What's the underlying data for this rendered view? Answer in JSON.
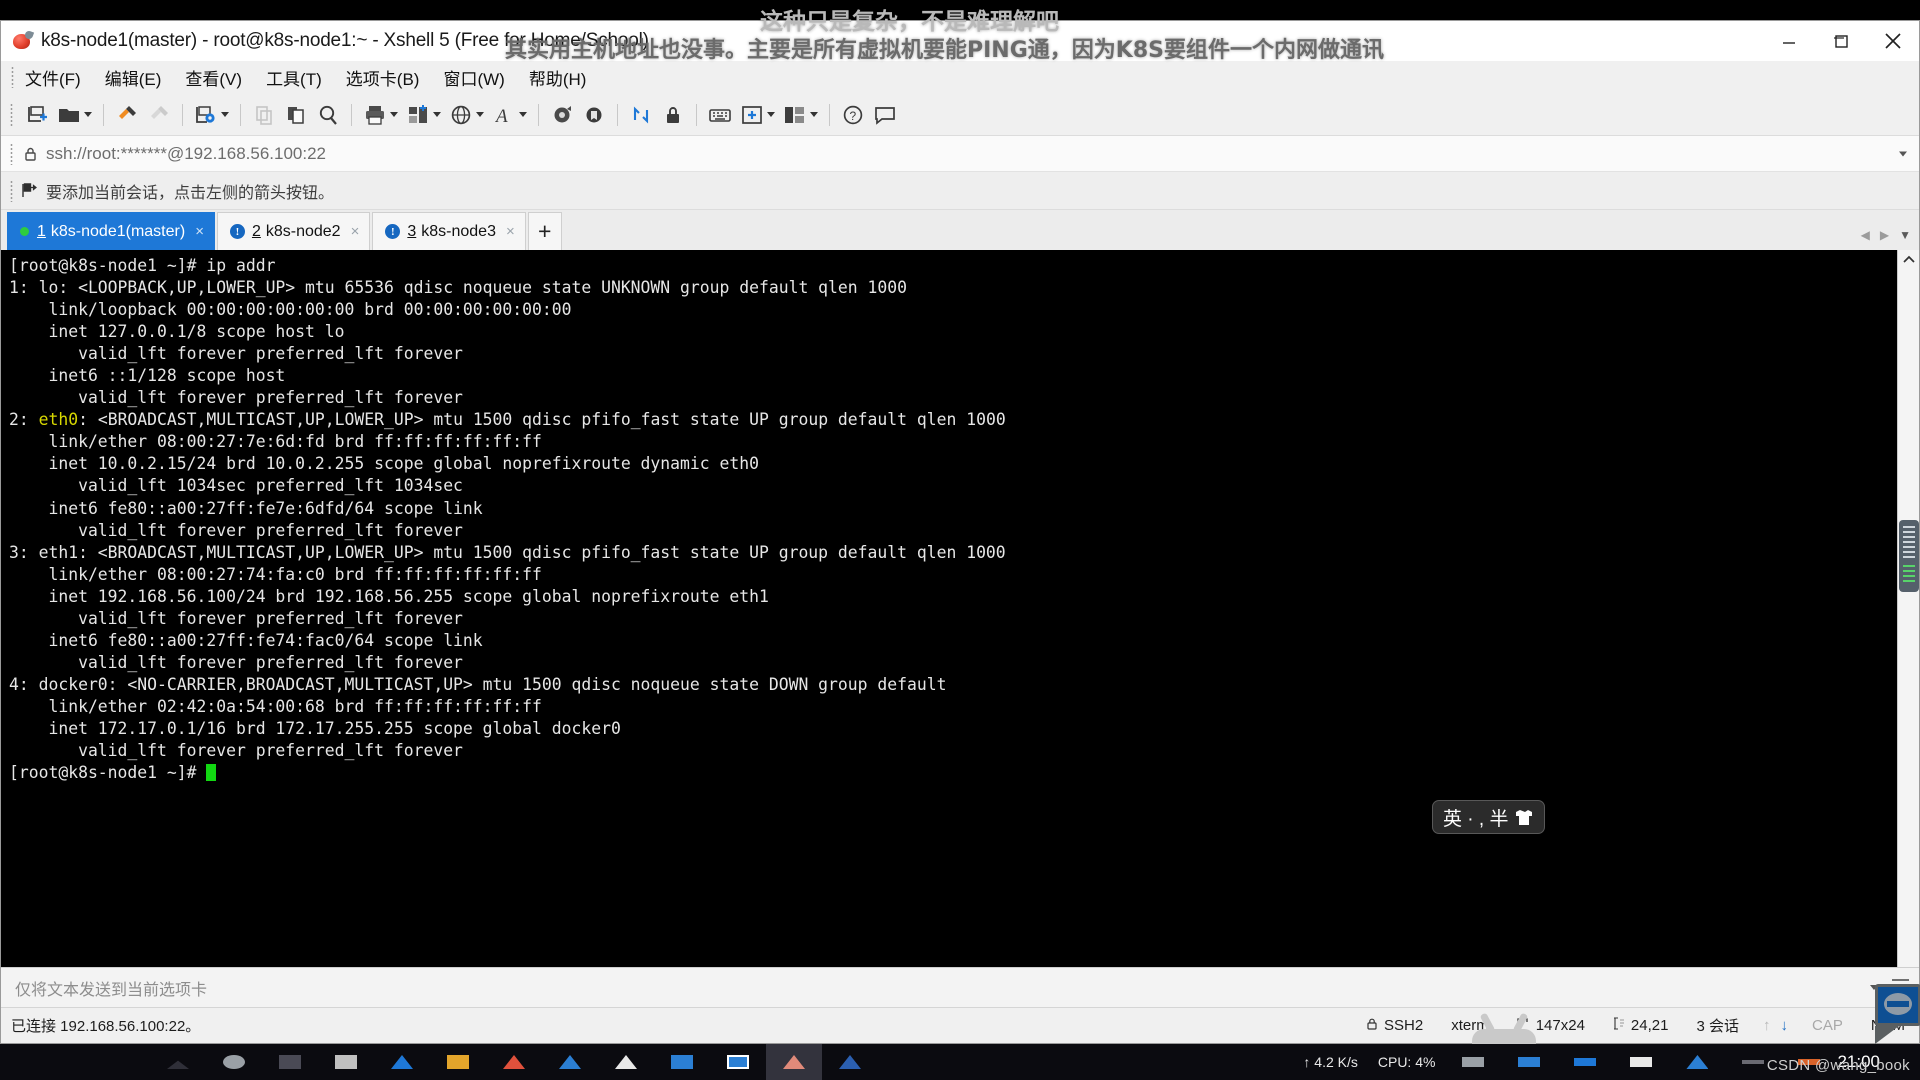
{
  "window": {
    "title": "k8s-node1(master) - root@k8s-node1:~ - Xshell 5 (Free for Home/School)",
    "app_icon": "xshell-icon",
    "minimize": "—",
    "maximize": "❐",
    "close": "✕"
  },
  "overlay": {
    "line1": "这种只是复杂，不是难理解吧",
    "line2": "其实用主机地址也没事。主要是所有虚拟机要能PING通，因为K8S要组件一个内网做通讯",
    "watermark": "CSDN @wang_book"
  },
  "menu": [
    {
      "label": "文件(F)"
    },
    {
      "label": "编辑(E)"
    },
    {
      "label": "查看(V)"
    },
    {
      "label": "工具(T)"
    },
    {
      "label": "选项卡(B)"
    },
    {
      "label": "窗口(W)"
    },
    {
      "label": "帮助(H)"
    }
  ],
  "toolbar": {
    "buttons": [
      {
        "name": "new-session-icon",
        "caret": false
      },
      {
        "name": "open-folder-icon",
        "caret": true
      },
      {
        "name": "separator",
        "caret": false
      },
      {
        "name": "quick-connect-icon",
        "caret": false
      },
      {
        "name": "disconnect-icon",
        "caret": false
      },
      {
        "name": "separator",
        "caret": false
      },
      {
        "name": "properties-icon",
        "caret": true
      },
      {
        "name": "separator",
        "caret": false
      },
      {
        "name": "copy-icon",
        "caret": false
      },
      {
        "name": "paste-icon",
        "caret": false
      },
      {
        "name": "find-icon",
        "caret": false
      },
      {
        "name": "separator",
        "caret": false
      },
      {
        "name": "print-icon",
        "caret": true
      },
      {
        "name": "layout-icon",
        "caret": true
      },
      {
        "name": "globe-icon",
        "caret": true
      },
      {
        "name": "font-icon",
        "caret": true
      },
      {
        "name": "separator",
        "caret": false
      },
      {
        "name": "log-icon",
        "caret": false
      },
      {
        "name": "keylog-icon",
        "caret": false
      },
      {
        "name": "separator",
        "caret": false
      },
      {
        "name": "transfer-icon",
        "caret": false
      },
      {
        "name": "lock-icon",
        "caret": false
      },
      {
        "name": "separator",
        "caret": false
      },
      {
        "name": "keyboard-icon",
        "caret": false
      },
      {
        "name": "add-panel-icon",
        "caret": true
      },
      {
        "name": "split-view-icon",
        "caret": true
      },
      {
        "name": "separator",
        "caret": false
      },
      {
        "name": "help-icon",
        "caret": false
      },
      {
        "name": "chat-icon",
        "caret": false
      }
    ]
  },
  "address_bar": {
    "icon": "lock-icon",
    "value": "ssh://root:*******@192.168.56.100:22"
  },
  "hint_bar": {
    "icon": "arrow-flag-icon",
    "text": "要添加当前会话，点击左侧的箭头按钮。"
  },
  "tabs": {
    "items": [
      {
        "num": "1",
        "label": "k8s-node1(master)",
        "status": "connected",
        "active": true,
        "close": "×"
      },
      {
        "num": "2",
        "label": "k8s-node2",
        "status": "alert",
        "active": false,
        "close": "×"
      },
      {
        "num": "3",
        "label": "k8s-node3",
        "status": "alert",
        "active": false,
        "close": "×"
      }
    ],
    "add_label": "+",
    "alert_glyph": "!"
  },
  "terminal": {
    "lines": [
      "[root@k8s-node1 ~]# ip addr",
      "1: lo: <LOOPBACK,UP,LOWER_UP> mtu 65536 qdisc noqueue state UNKNOWN group default qlen 1000",
      "    link/loopback 00:00:00:00:00:00 brd 00:00:00:00:00:00",
      "    inet 127.0.0.1/8 scope host lo",
      "       valid_lft forever preferred_lft forever",
      "    inet6 ::1/128 scope host",
      "       valid_lft forever preferred_lft forever",
      "2: eth0: <BROADCAST,MULTICAST,UP,LOWER_UP> mtu 1500 qdisc pfifo_fast state UP group default qlen 1000",
      "    link/ether 08:00:27:7e:6d:fd brd ff:ff:ff:ff:ff:ff",
      "    inet 10.0.2.15/24 brd 10.0.2.255 scope global noprefixroute dynamic eth0",
      "       valid_lft 1034sec preferred_lft 1034sec",
      "    inet6 fe80::a00:27ff:fe7e:6dfd/64 scope link",
      "       valid_lft forever preferred_lft forever",
      "3: eth1: <BROADCAST,MULTICAST,UP,LOWER_UP> mtu 1500 qdisc pfifo_fast state UP group default qlen 1000",
      "    link/ether 08:00:27:74:fa:c0 brd ff:ff:ff:ff:ff:ff",
      "    inet 192.168.56.100/24 brd 192.168.56.255 scope global noprefixroute eth1",
      "       valid_lft forever preferred_lft forever",
      "    inet6 fe80::a00:27ff:fe74:fac0/64 scope link",
      "       valid_lft forever preferred_lft forever",
      "4: docker0: <NO-CARRIER,BROADCAST,MULTICAST,UP> mtu 1500 qdisc noqueue state DOWN group default",
      "    link/ether 02:42:0a:54:00:68 brd ff:ff:ff:ff:ff:ff",
      "    inet 172.17.0.1/16 brd 172.17.255.255 scope global docker0",
      "       valid_lft forever preferred_lft forever"
    ],
    "prompt": "[root@k8s-node1 ~]# ",
    "highlight_word": "eth0",
    "highlight_line_index": 7,
    "colors": {
      "background": "#000000",
      "foreground": "#e6e6e6",
      "cursor": "#12d812",
      "highlight": "#d8d800"
    }
  },
  "send_bar": {
    "placeholder": "仅将文本发送到当前选项卡"
  },
  "status_bar": {
    "connection": "已连接 192.168.56.100:22。",
    "protocol": "SSH2",
    "terminal_type": "xterm",
    "size": "147x24",
    "cursor_pos": "24,21",
    "sessions": "3 会话",
    "cap": "CAP",
    "num": "NUM",
    "protocol_icon": "lock-icon",
    "size_icon": "resize-icon",
    "cursor_icon": "caret-icon",
    "up_arrow": "↑",
    "down_arrow": "↓"
  },
  "ime": {
    "text": "英 · , 半",
    "icon": "shirt-icon"
  },
  "taskbar": {
    "network_speed": "↑ 4.2 K/s",
    "cpu": "CPU: 4%",
    "clock": "21:00"
  }
}
